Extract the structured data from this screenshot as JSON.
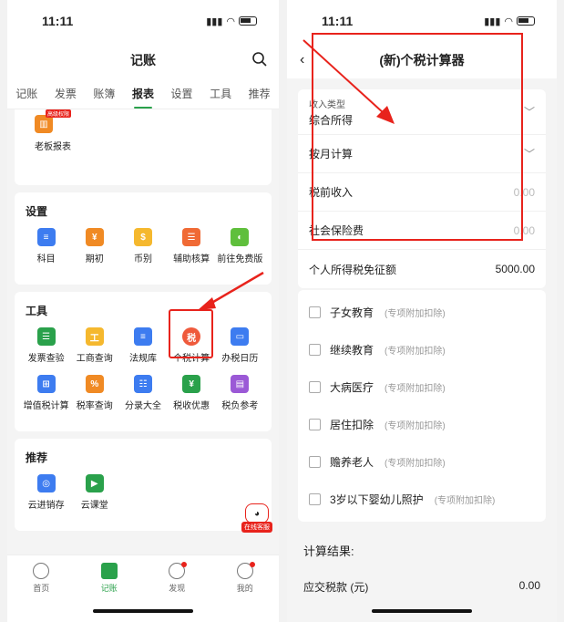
{
  "left": {
    "status": {
      "time": "11:11"
    },
    "nav_title": "记账",
    "tabs": [
      {
        "label": "记账",
        "active": false
      },
      {
        "label": "发票",
        "active": false
      },
      {
        "label": "账簿",
        "active": false
      },
      {
        "label": "报表",
        "active": true
      },
      {
        "label": "设置",
        "active": false
      },
      {
        "label": "工具",
        "active": false
      },
      {
        "label": "推荐",
        "active": false
      }
    ],
    "boss": {
      "label": "老板报表",
      "badge": "高级权限"
    },
    "settings": {
      "title": "设置",
      "items": [
        {
          "label": "科目",
          "icon": "account-subject-icon",
          "color": "#3d7cf0",
          "glyph": "≡"
        },
        {
          "label": "期初",
          "icon": "period-start-icon",
          "color": "#f08a24",
          "glyph": "¥"
        },
        {
          "label": "币别",
          "icon": "currency-icon",
          "color": "#f5b82e",
          "glyph": "$"
        },
        {
          "label": "辅助核算",
          "icon": "auxiliary-accounting-icon",
          "color": "#f06a35",
          "glyph": "☰"
        },
        {
          "label": "前往免费版",
          "icon": "free-version-icon",
          "color": "#5fbf3c",
          "glyph": "◐"
        }
      ]
    },
    "tools": {
      "title": "工具",
      "items": [
        {
          "label": "发票查验",
          "icon": "invoice-check-icon",
          "color": "#2aa14b",
          "glyph": "☰"
        },
        {
          "label": "工商查询",
          "icon": "business-query-icon",
          "color": "#f5b82e",
          "glyph": "工"
        },
        {
          "label": "法规库",
          "icon": "regulations-icon",
          "color": "#3d7cf0",
          "glyph": "≡"
        },
        {
          "label": "个税计算",
          "icon": "personal-tax-icon",
          "color": "#ef5a3c",
          "glyph": "税"
        },
        {
          "label": "办税日历",
          "icon": "tax-calendar-icon",
          "color": "#3d7cf0",
          "glyph": "▭"
        },
        {
          "label": "增值税计算",
          "icon": "vat-calc-icon",
          "color": "#3d7cf0",
          "glyph": "⊞"
        },
        {
          "label": "税率查询",
          "icon": "tax-rate-icon",
          "color": "#f08a24",
          "glyph": "%"
        },
        {
          "label": "分录大全",
          "icon": "entries-icon",
          "color": "#3d7cf0",
          "glyph": "☷"
        },
        {
          "label": "税收优惠",
          "icon": "tax-benefit-icon",
          "color": "#2aa14b",
          "glyph": "¥"
        },
        {
          "label": "税负参考",
          "icon": "tax-burden-icon",
          "color": "#9b59d6",
          "glyph": "▤"
        }
      ]
    },
    "recommend": {
      "title": "推荐",
      "items": [
        {
          "label": "云进销存",
          "icon": "cloud-inventory-icon",
          "color": "#3d7cf0",
          "glyph": "◎"
        },
        {
          "label": "云课堂",
          "icon": "cloud-classroom-icon",
          "color": "#2aa14b",
          "glyph": "▶"
        }
      ]
    },
    "service_label": "在线客服",
    "bottom_nav": [
      {
        "label": "首页",
        "icon": "home-icon",
        "active": false,
        "dot": false
      },
      {
        "label": "记账",
        "icon": "bookkeeping-icon",
        "active": true,
        "dot": false
      },
      {
        "label": "发现",
        "icon": "discover-icon",
        "active": false,
        "dot": true
      },
      {
        "label": "我的",
        "icon": "profile-icon",
        "active": false,
        "dot": true
      }
    ]
  },
  "right": {
    "status": {
      "time": "11:11"
    },
    "nav_title": "(新)个税计算器",
    "income_type_label": "收入类型",
    "income_type_value": "综合所得",
    "calc_mode": "按月计算",
    "pretax_label": "税前收入",
    "pretax_value": "0.00",
    "social_label": "社会保险费",
    "social_value": "0.00",
    "exempt_label": "个人所得税免征额",
    "exempt_value": "5000.00",
    "deduction_note": "(专项附加扣除)",
    "deductions": [
      "子女教育",
      "继续教育",
      "大病医疗",
      "居住扣除",
      "赡养老人",
      "3岁以下婴幼儿照护"
    ],
    "result_title": "计算结果:",
    "tax_label": "应交税款 (元)",
    "tax_value": "0.00"
  },
  "colors": {
    "accent": "#2aa14b",
    "highlight": "#e8231c"
  }
}
